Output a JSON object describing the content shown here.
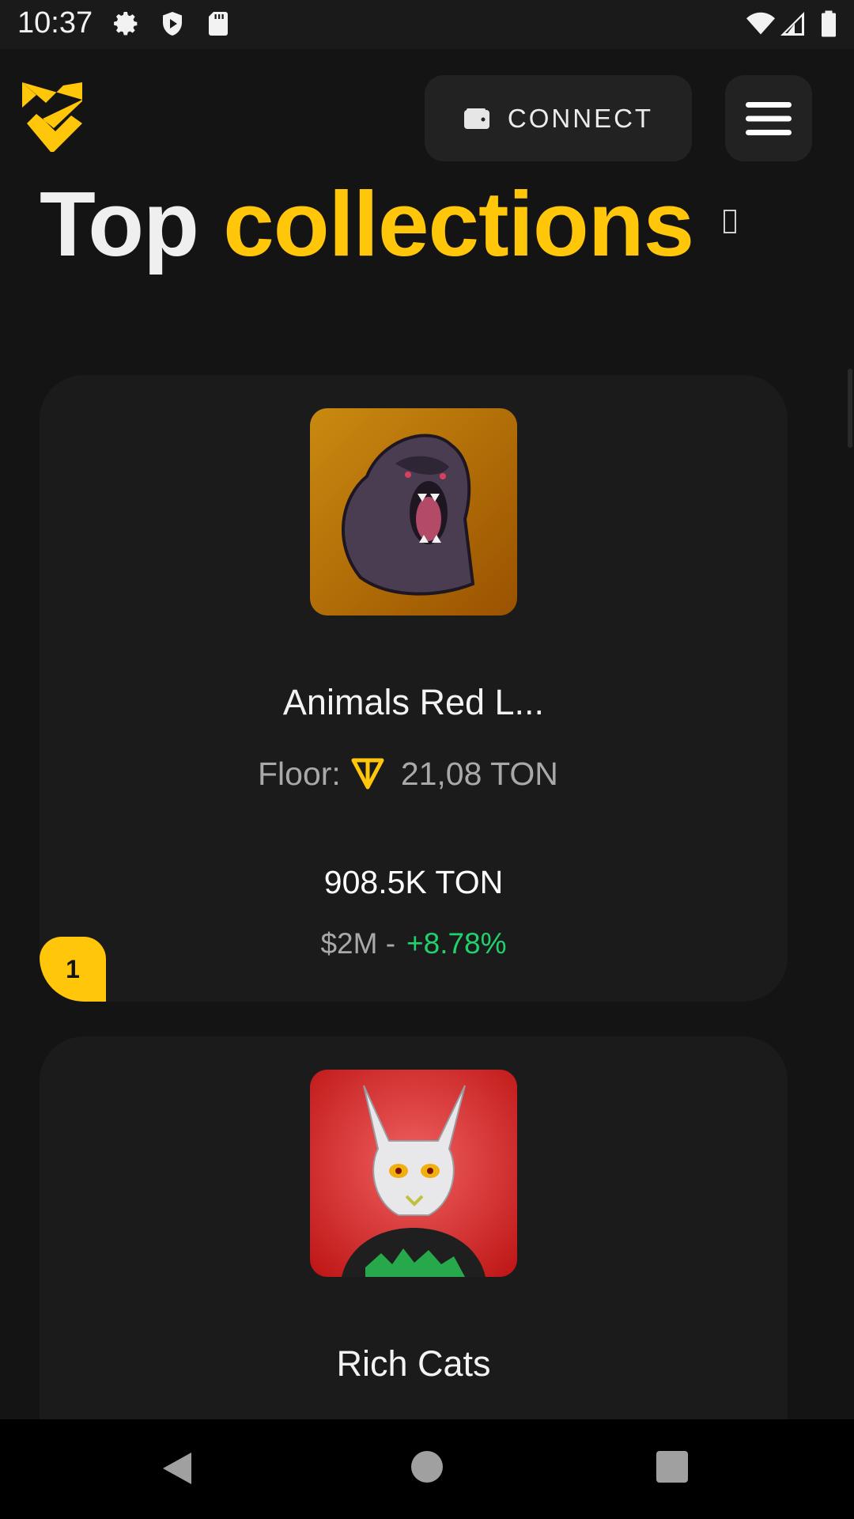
{
  "status_bar": {
    "time": "10:37",
    "left_icons": [
      "gear-icon",
      "shield-play-icon",
      "sd-card-icon"
    ],
    "right_icons": [
      "wifi-icon",
      "signal-icon",
      "battery-icon"
    ]
  },
  "header": {
    "logo": "brand-logo",
    "connect_label": "CONNECT",
    "connect_icon": "wallet-icon",
    "menu_icon": "hamburger-menu-icon"
  },
  "page": {
    "title_word_1": "Top",
    "title_word_2": "collections"
  },
  "collections": [
    {
      "name": "Animals Red L...",
      "floor_label": "Floor:",
      "floor_value": "21,08 TON",
      "volume": "908.5K TON",
      "usd": "$2M -",
      "change": "+8.78%",
      "rank": "1",
      "thumb_icon": "gorilla-avatar"
    },
    {
      "name": "Rich Cats",
      "thumb_icon": "cat-avatar"
    }
  ],
  "colors": {
    "accent": "#ffc60a",
    "background": "#141414",
    "card": "#1b1b1b",
    "positive": "#1fd26c"
  },
  "nav_bar": {
    "icons": [
      "back-icon",
      "home-icon",
      "recents-icon"
    ]
  }
}
